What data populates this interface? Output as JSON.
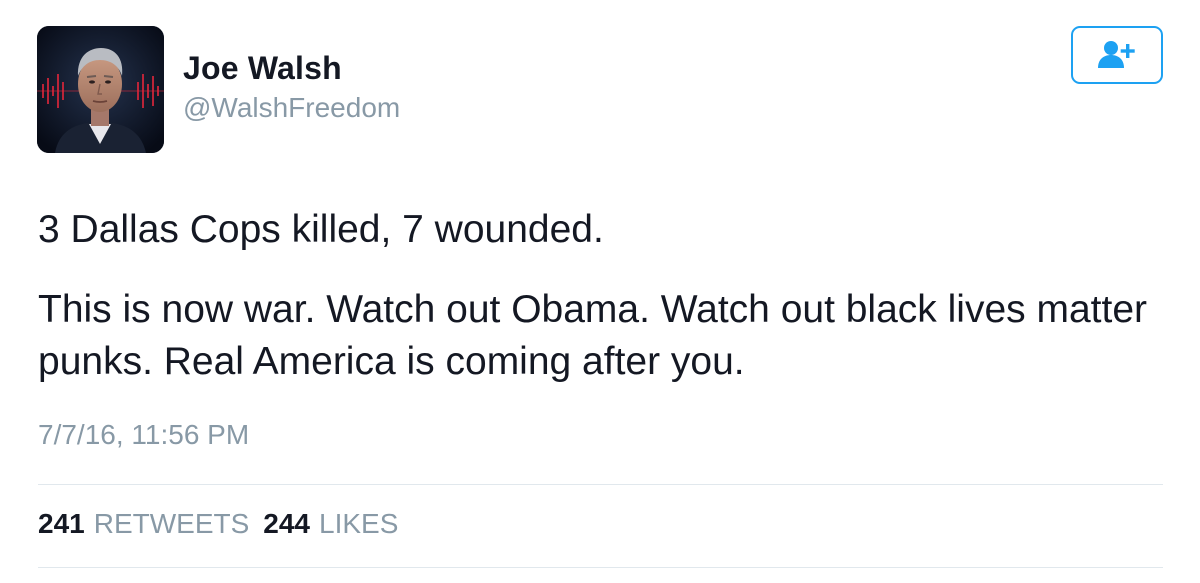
{
  "tweet": {
    "author": {
      "name": "Joe Walsh",
      "handle": "@WalshFreedom"
    },
    "follow_button_icon": "add-user-icon",
    "text": {
      "line1": "3 Dallas Cops killed, 7 wounded.",
      "line2": "This is now war. Watch out Obama. Watch out black lives matter punks. Real America is coming after you."
    },
    "timestamp": "7/7/16, 11:56 PM",
    "stats": {
      "retweets_count": "241",
      "retweets_label": "RETWEETS",
      "likes_count": "244",
      "likes_label": "LIKES"
    }
  },
  "colors": {
    "accent": "#1da1f2",
    "secondary_text": "#8899a6",
    "primary_text": "#141823",
    "divider": "#e1e8ed"
  }
}
